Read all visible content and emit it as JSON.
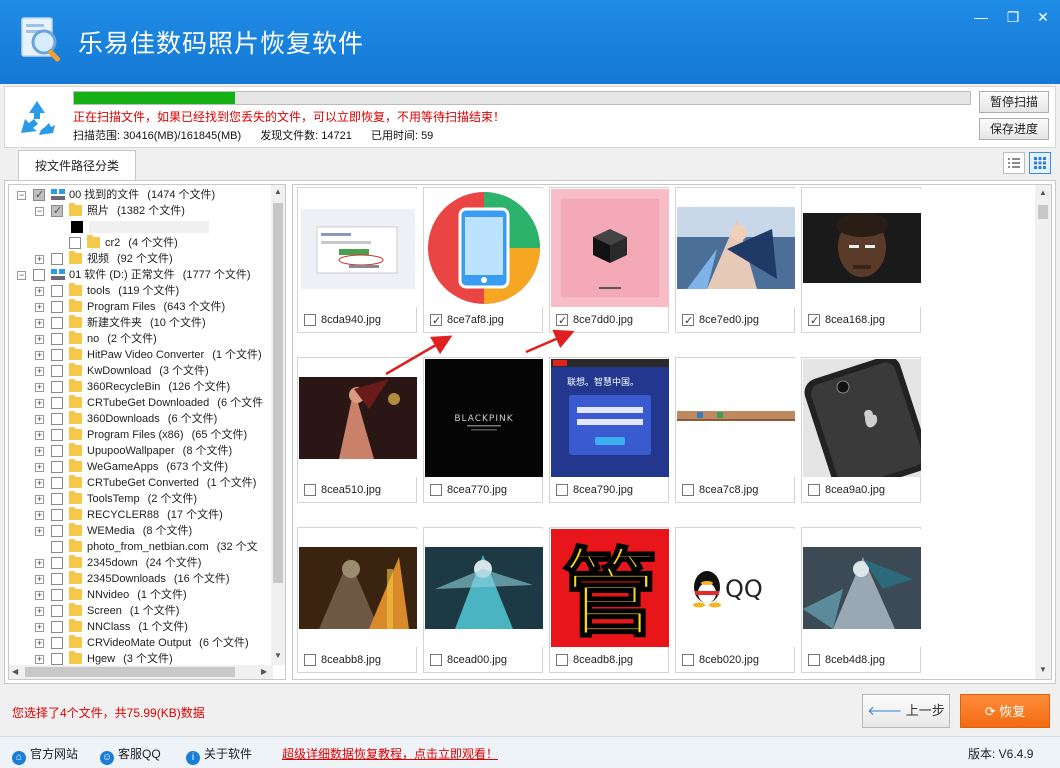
{
  "window": {
    "title": "乐易佳数码照片恢复软件",
    "controls": [
      "minimize",
      "maximize",
      "close"
    ]
  },
  "scan": {
    "progress_percent": 18,
    "message": "正在扫描文件，如果已经找到您丢失的文件，可以立即恢复，不用等待扫描结束！",
    "range_label": "扫描范围: 30416(MB)/161845(MB)",
    "found_label": "发现文件数: 14721",
    "time_label": "已用时间: 59",
    "pause_label": "暂停扫描",
    "save_label": "保存进度"
  },
  "tabs": [
    {
      "label": "按文件路径分类",
      "active": true
    }
  ],
  "view_modes": [
    "list-view-icon",
    "grid-view-icon"
  ],
  "tree": [
    {
      "depth": 0,
      "exp": "−",
      "check": "partial",
      "icon": "drive",
      "name": "00 找到的文件",
      "count": "(1474 个文件)"
    },
    {
      "depth": 1,
      "exp": "−",
      "check": "partial",
      "icon": "folder",
      "name": "照片",
      "count": "(1382 个文件)"
    },
    {
      "depth": 2,
      "exp": "",
      "check": "none",
      "icon": "blackbox",
      "name": "",
      "count": ""
    },
    {
      "depth": 2,
      "exp": "",
      "check": "none",
      "icon": "folder",
      "name": "cr2",
      "count": "(4 个文件)"
    },
    {
      "depth": 1,
      "exp": "+",
      "check": "none",
      "icon": "folder",
      "name": "视频",
      "count": "(92 个文件)"
    },
    {
      "depth": 0,
      "exp": "−",
      "check": "none",
      "icon": "drive",
      "name": "01 软件 (D:) 正常文件",
      "count": "(1777 个文件)"
    },
    {
      "depth": 1,
      "exp": "+",
      "check": "none",
      "icon": "folder",
      "name": "tools",
      "count": "(119 个文件)"
    },
    {
      "depth": 1,
      "exp": "+",
      "check": "none",
      "icon": "folder",
      "name": "Program Files",
      "count": "(643 个文件)"
    },
    {
      "depth": 1,
      "exp": "+",
      "check": "none",
      "icon": "folder",
      "name": "新建文件夹",
      "count": "(10 个文件)"
    },
    {
      "depth": 1,
      "exp": "+",
      "check": "none",
      "icon": "folder",
      "name": "no",
      "count": "(2 个文件)"
    },
    {
      "depth": 1,
      "exp": "+",
      "check": "none",
      "icon": "folder",
      "name": "HitPaw Video Converter",
      "count": "(1 个文件)"
    },
    {
      "depth": 1,
      "exp": "+",
      "check": "none",
      "icon": "folder",
      "name": "KwDownload",
      "count": "(3 个文件)"
    },
    {
      "depth": 1,
      "exp": "+",
      "check": "none",
      "icon": "folder",
      "name": "360RecycleBin",
      "count": "(126 个文件)"
    },
    {
      "depth": 1,
      "exp": "+",
      "check": "none",
      "icon": "folder",
      "name": "CRTubeGet Downloaded",
      "count": "(6 个文件"
    },
    {
      "depth": 1,
      "exp": "+",
      "check": "none",
      "icon": "folder",
      "name": "360Downloads",
      "count": "(6 个文件)"
    },
    {
      "depth": 1,
      "exp": "+",
      "check": "none",
      "icon": "folder",
      "name": "Program Files (x86)",
      "count": "(65 个文件)"
    },
    {
      "depth": 1,
      "exp": "+",
      "check": "none",
      "icon": "folder",
      "name": "UpupooWallpaper",
      "count": "(8 个文件)"
    },
    {
      "depth": 1,
      "exp": "+",
      "check": "none",
      "icon": "folder",
      "name": "WeGameApps",
      "count": "(673 个文件)"
    },
    {
      "depth": 1,
      "exp": "+",
      "check": "none",
      "icon": "folder",
      "name": "CRTubeGet Converted",
      "count": "(1 个文件)"
    },
    {
      "depth": 1,
      "exp": "+",
      "check": "none",
      "icon": "folder",
      "name": "ToolsTemp",
      "count": "(2 个文件)"
    },
    {
      "depth": 1,
      "exp": "+",
      "check": "none",
      "icon": "folder",
      "name": "RECYCLER88",
      "count": "(17 个文件)"
    },
    {
      "depth": 1,
      "exp": "+",
      "check": "none",
      "icon": "folder",
      "name": "WEMedia",
      "count": "(8 个文件)"
    },
    {
      "depth": 1,
      "exp": "",
      "check": "none",
      "icon": "folder",
      "name": "photo_from_netbian.com",
      "count": "(32 个文"
    },
    {
      "depth": 1,
      "exp": "+",
      "check": "none",
      "icon": "folder",
      "name": "2345down",
      "count": "(24 个文件)"
    },
    {
      "depth": 1,
      "exp": "+",
      "check": "none",
      "icon": "folder",
      "name": "2345Downloads",
      "count": "(16 个文件)"
    },
    {
      "depth": 1,
      "exp": "+",
      "check": "none",
      "icon": "folder",
      "name": "NNvideo",
      "count": "(1 个文件)"
    },
    {
      "depth": 1,
      "exp": "+",
      "check": "none",
      "icon": "folder",
      "name": "Screen",
      "count": "(1 个文件)"
    },
    {
      "depth": 1,
      "exp": "+",
      "check": "none",
      "icon": "folder",
      "name": "NNClass",
      "count": "(1 个文件)"
    },
    {
      "depth": 1,
      "exp": "+",
      "check": "none",
      "icon": "folder",
      "name": "CRVideoMate Output",
      "count": "(6 个文件)"
    },
    {
      "depth": 1,
      "exp": "+",
      "check": "none",
      "icon": "folder",
      "name": "Hgew",
      "count": "(3 个文件)"
    }
  ],
  "files": [
    {
      "name": "8cda940.jpg",
      "checked": false,
      "thumb": "screenshot"
    },
    {
      "name": "8ce7af8.jpg",
      "checked": true,
      "thumb": "phone-app"
    },
    {
      "name": "8ce7dd0.jpg",
      "checked": true,
      "thumb": "pink-box"
    },
    {
      "name": "8ce7ed0.jpg",
      "checked": true,
      "thumb": "game-art-1"
    },
    {
      "name": "8cea168.jpg",
      "checked": true,
      "thumb": "portrait"
    },
    {
      "name": "8cea510.jpg",
      "checked": false,
      "thumb": "game-art-2"
    },
    {
      "name": "8cea770.jpg",
      "checked": false,
      "thumb": "blackpink"
    },
    {
      "name": "8cea790.jpg",
      "checked": false,
      "thumb": "lenovo"
    },
    {
      "name": "8cea7c8.jpg",
      "checked": false,
      "thumb": "desktop-strip"
    },
    {
      "name": "8cea9a0.jpg",
      "checked": false,
      "thumb": "iphone"
    },
    {
      "name": "8ceabb8.jpg",
      "checked": false,
      "thumb": "game-art-3"
    },
    {
      "name": "8cead00.jpg",
      "checked": false,
      "thumb": "game-art-4"
    },
    {
      "name": "8ceadb8.jpg",
      "checked": false,
      "thumb": "guan-char"
    },
    {
      "name": "8ceb020.jpg",
      "checked": false,
      "thumb": "qq-logo"
    },
    {
      "name": "8ceb4d8.jpg",
      "checked": false,
      "thumb": "game-art-5"
    }
  ],
  "thumb_text": {
    "blackpink": "BLACKPINK",
    "guan": "管",
    "qq": "QQ",
    "lenovo_line1": "联想。智慧中国。"
  },
  "bottom": {
    "selected_info": "您选择了4个文件，共75.99(KB)数据",
    "prev_label": "上一步",
    "recover_label": "恢复"
  },
  "footer": {
    "website_label": "官方网站",
    "support_label": "客服QQ",
    "about_label": "关于软件",
    "tutorial_label": "超级详细数据恢复教程，点击立即观看！",
    "version_label": "版本: V6.4.9"
  },
  "colors": {
    "title_bar": "#1a84df",
    "progress": "#14b014",
    "alert_text": "#e00000",
    "recover_button": "#f47a20"
  }
}
